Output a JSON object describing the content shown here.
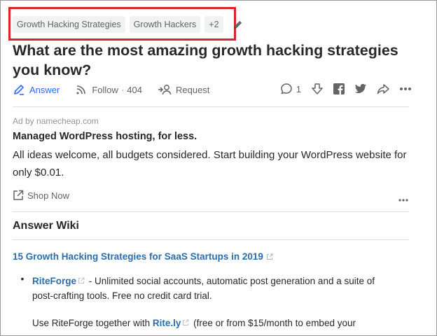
{
  "tags": [
    "Growth Hacking Strategies",
    "Growth Hackers",
    "+2"
  ],
  "question": {
    "title": "What are the most amazing growth hacking strategies you know?"
  },
  "actions": {
    "answer_label": "Answer",
    "follow_label": "Follow",
    "follow_sep": "·",
    "follow_count": "404",
    "request_label": "Request",
    "comment_count": "1"
  },
  "ad": {
    "by": "Ad by namecheap.com",
    "title": "Managed WordPress hosting, for less.",
    "text": "All ideas welcome, all budgets considered. Start building your WordPress website for only $0.01.",
    "cta": "Shop Now"
  },
  "wiki": {
    "heading": "Answer Wiki",
    "link_title": "15 Growth Hacking Strategies for SaaS Startups in 2019",
    "item1_link": "RiteForge",
    "item1_text": " - Unlimited social accounts, automatic post generation and a suite of post-crafting tools. Free no credit card trial.",
    "item2_prefix": "Use RiteForge together with ",
    "item2_link": "Rite.ly",
    "item2_text": " (free or from $15/month to embed your"
  },
  "colors": {
    "accent": "#2e69ff",
    "link": "#2b6dad",
    "highlight": "#d9232d"
  }
}
